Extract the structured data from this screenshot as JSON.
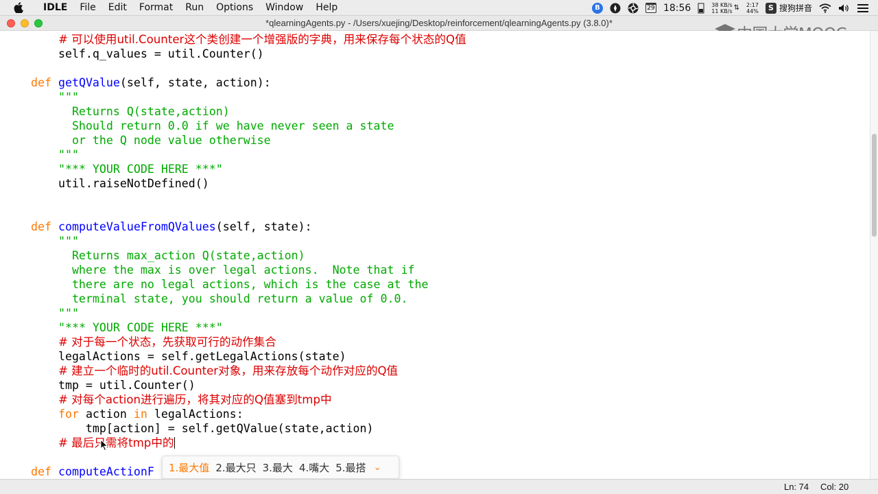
{
  "menubar": {
    "app": "IDLE",
    "items": [
      "File",
      "Edit",
      "Format",
      "Run",
      "Options",
      "Window",
      "Help"
    ],
    "calendar_day": "29",
    "clock": "18:56",
    "net_up": "38 KB/s",
    "net_down": "11 KB/s",
    "battery_time": "2:17",
    "battery_percent": "44%",
    "input_method": "搜狗拼音"
  },
  "window": {
    "title": "*qlearningAgents.py - /Users/xuejing/Desktop/reinforcement/qlearningAgents.py (3.8.0)*"
  },
  "watermark": {
    "text": "中国大学MOOC"
  },
  "editor": {
    "lines": [
      {
        "segments": [
          {
            "t": "    "
          },
          {
            "c": "cmt",
            "t": "# 可以使用util.Counter这个类创建一个增强版的字典，用来保存每个状态的Q值"
          }
        ]
      },
      {
        "segments": [
          {
            "t": "    self.q_values = util.Counter()"
          }
        ]
      },
      {
        "segments": [
          {
            "t": ""
          }
        ]
      },
      {
        "segments": [
          {
            "c": "kw",
            "t": "def"
          },
          {
            "t": " "
          },
          {
            "c": "def",
            "t": "getQValue"
          },
          {
            "t": "(self, state, action):"
          }
        ]
      },
      {
        "segments": [
          {
            "t": "    "
          },
          {
            "c": "str",
            "t": "\"\"\""
          }
        ]
      },
      {
        "segments": [
          {
            "c": "str",
            "t": "      Returns Q(state,action)"
          }
        ]
      },
      {
        "segments": [
          {
            "c": "str",
            "t": "      Should return 0.0 if we have never seen a state"
          }
        ]
      },
      {
        "segments": [
          {
            "c": "str",
            "t": "      or the Q node value otherwise"
          }
        ]
      },
      {
        "segments": [
          {
            "c": "str",
            "t": "    \"\"\""
          }
        ]
      },
      {
        "segments": [
          {
            "t": "    "
          },
          {
            "c": "str",
            "t": "\"*** YOUR CODE HERE ***\""
          }
        ]
      },
      {
        "segments": [
          {
            "t": "    util.raiseNotDefined()"
          }
        ]
      },
      {
        "segments": [
          {
            "t": ""
          }
        ]
      },
      {
        "segments": [
          {
            "t": ""
          }
        ]
      },
      {
        "segments": [
          {
            "c": "kw",
            "t": "def"
          },
          {
            "t": " "
          },
          {
            "c": "def",
            "t": "computeValueFromQValues"
          },
          {
            "t": "(self, state):"
          }
        ]
      },
      {
        "segments": [
          {
            "t": "    "
          },
          {
            "c": "str",
            "t": "\"\"\""
          }
        ]
      },
      {
        "segments": [
          {
            "c": "str",
            "t": "      Returns max_action Q(state,action)"
          }
        ]
      },
      {
        "segments": [
          {
            "c": "str",
            "t": "      where the max is over legal actions.  Note that if"
          }
        ]
      },
      {
        "segments": [
          {
            "c": "str",
            "t": "      there are no legal actions, which is the case at the"
          }
        ]
      },
      {
        "segments": [
          {
            "c": "str",
            "t": "      terminal state, you should return a value of 0.0."
          }
        ]
      },
      {
        "segments": [
          {
            "c": "str",
            "t": "    \"\"\""
          }
        ]
      },
      {
        "segments": [
          {
            "t": "    "
          },
          {
            "c": "str",
            "t": "\"*** YOUR CODE HERE ***\""
          }
        ]
      },
      {
        "segments": [
          {
            "t": "    "
          },
          {
            "c": "cmt",
            "t": "# 对于每一个状态，先获取可行的动作集合"
          }
        ]
      },
      {
        "segments": [
          {
            "t": "    legalActions = self.getLegalActions(state)"
          }
        ]
      },
      {
        "segments": [
          {
            "t": "    "
          },
          {
            "c": "cmt",
            "t": "# 建立一个临时的util.Counter对象，用来存放每个动作对应的Q值"
          }
        ]
      },
      {
        "segments": [
          {
            "t": "    tmp = util.Counter()"
          }
        ]
      },
      {
        "segments": [
          {
            "t": "    "
          },
          {
            "c": "cmt",
            "t": "# 对每个action进行遍历，将其对应的Q值塞到tmp中"
          }
        ]
      },
      {
        "segments": [
          {
            "t": "    "
          },
          {
            "c": "kw",
            "t": "for"
          },
          {
            "t": " action "
          },
          {
            "c": "kw",
            "t": "in"
          },
          {
            "t": " legalActions:"
          }
        ]
      },
      {
        "segments": [
          {
            "t": "        tmp[action] = self.getQValue(state,action)"
          }
        ]
      },
      {
        "segments": [
          {
            "t": "    "
          },
          {
            "c": "cmt",
            "t": "# 最后只需将tmp中的"
          }
        ],
        "cursor": true
      },
      {
        "segments": [
          {
            "t": ""
          }
        ]
      },
      {
        "segments": [
          {
            "c": "kw",
            "t": "def"
          },
          {
            "t": " "
          },
          {
            "c": "def",
            "t": "computeActionF"
          }
        ]
      }
    ]
  },
  "ime": {
    "candidates": [
      "1.最大值",
      "2.最大只",
      "3.最大",
      "4.嘴大",
      "5.最搭"
    ],
    "selected_index": 0
  },
  "statusbar": {
    "ln": "Ln: 74",
    "col": "Col: 20"
  },
  "colors": {
    "keyword": "#ff7700",
    "definition": "#0000ff",
    "string": "#00aa00",
    "comment": "#dd0000",
    "ime_selected": "#ff7a00"
  }
}
